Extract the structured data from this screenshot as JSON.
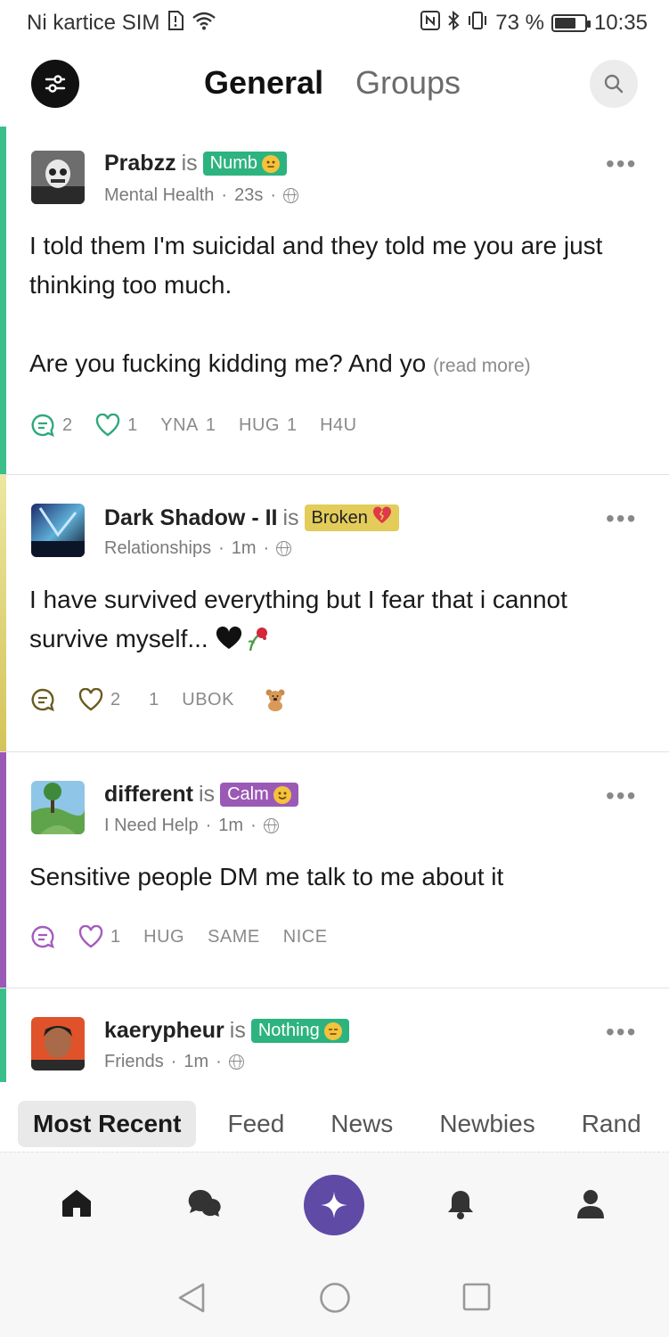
{
  "status_bar": {
    "carrier": "Ni kartice SIM",
    "battery_percent": "73 %",
    "battery_level": 0.73,
    "time": "10:35"
  },
  "header": {
    "tab_general": "General",
    "tab_groups": "Groups"
  },
  "posts": [
    {
      "user": "Prabzz",
      "is_word": "is",
      "mood": "Numb",
      "mood_color": "#2db37f",
      "accent": "#3bbf8a",
      "category": "Mental Health",
      "time": "23s",
      "text_line1": "I told them I'm suicidal and they told me you are just thinking too much.",
      "text_line2": "Are you fucking kidding me? And yo",
      "read_more": "(read more)",
      "comments": "2",
      "likes": "1",
      "reactions": [
        "YNA",
        "1",
        "HUG",
        "1",
        "H4U"
      ],
      "icon_color": "#2fa87a"
    },
    {
      "user": "Dark Shadow - II",
      "is_word": "is",
      "mood": "Broken",
      "mood_color": "#e3cc5a",
      "accent": "#d4c458",
      "category": "Relationships",
      "time": "1m",
      "text_line1": "I have survived everything but I fear that i cannot survive myself...",
      "likes": "2",
      "reactions": [
        "1",
        "UBOK"
      ],
      "icon_color": "#6b5a1e"
    },
    {
      "user": "different",
      "is_word": "is",
      "mood": "Calm",
      "mood_color": "#9b59b6",
      "accent": "#9b59b6",
      "category": "I Need Help",
      "time": "1m",
      "text_line1": "Sensitive people DM me talk to me about it",
      "likes": "1",
      "reactions": [
        "HUG",
        "SAME",
        "NICE"
      ],
      "icon_color": "#a35bbf"
    },
    {
      "user": "kaerypheur",
      "is_word": "is",
      "mood": "Nothing",
      "mood_color": "#2db37f",
      "accent": "#3bbf8a",
      "category": "Friends",
      "time": "1m"
    }
  ],
  "categories": [
    "Most Recent",
    "Feed",
    "News",
    "Newbies",
    "Rand"
  ],
  "bottom_nav": [
    "home-icon",
    "chat-icon",
    "sparkle-icon",
    "bell-icon",
    "profile-icon"
  ],
  "separator": "·"
}
